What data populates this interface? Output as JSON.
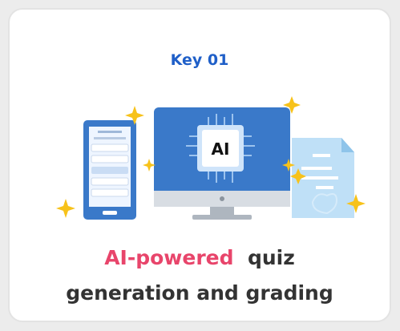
{
  "card": {
    "key_label": "Key 01",
    "headline_accent": "AI-powered",
    "headline_rest": "quiz",
    "headline_line2": "generation and grading"
  },
  "illustration": {
    "monitor_chip_text": "AI",
    "icons": [
      "phone-icon",
      "monitor-icon",
      "ai-chip-icon",
      "document-icon",
      "sparkle-icon"
    ]
  },
  "colors": {
    "key_label": "#1f5fc8",
    "accent": "#e8456b",
    "text": "#333333",
    "sparkle": "#f7c21a",
    "monitor_blue": "#3a79c9"
  }
}
